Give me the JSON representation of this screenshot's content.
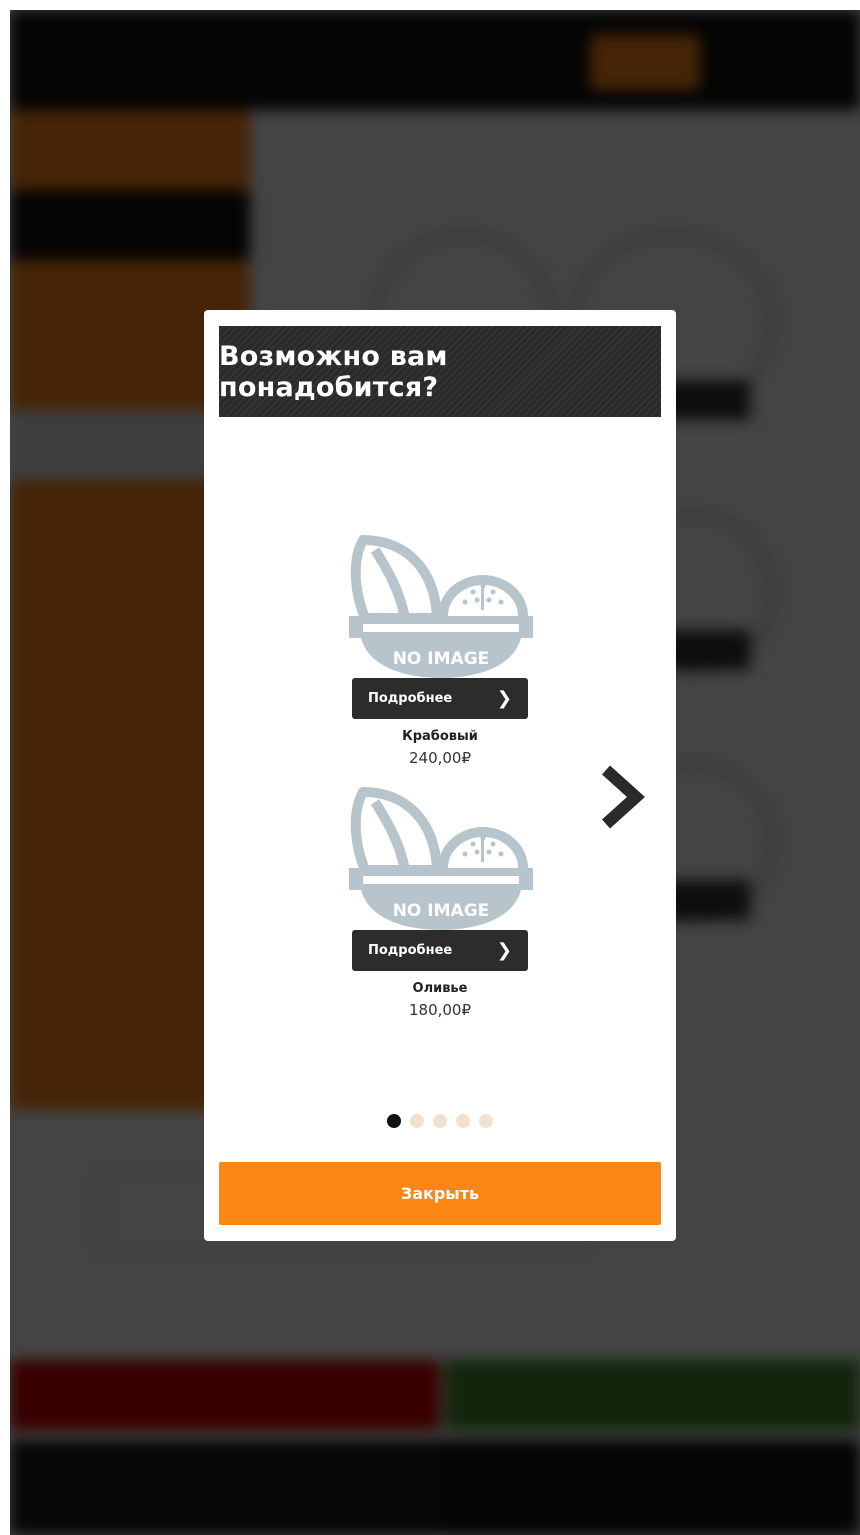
{
  "modal": {
    "title": "Возможно вам понадобится?",
    "products": [
      {
        "image_text": "NO IMAGE",
        "details_label": "Подробнее",
        "name": "Крабовый",
        "price": "240,00₽"
      },
      {
        "image_text": "NO IMAGE",
        "details_label": "Подробнее",
        "name": "Оливье",
        "price": "180,00₽"
      }
    ],
    "pagination": {
      "total": 5,
      "active": 1
    },
    "close_label": "Закрыть"
  },
  "icons": {
    "next": "chevron-right-icon",
    "details": "chevron-right-icon",
    "placeholder": "no-image-bowl-icon"
  },
  "colors": {
    "accent": "#fa8614",
    "header_bg": "#2a2a2a",
    "button_dark": "#2c2c2c",
    "dot_inactive": "#f3e1d0",
    "dot_active": "#111111"
  }
}
